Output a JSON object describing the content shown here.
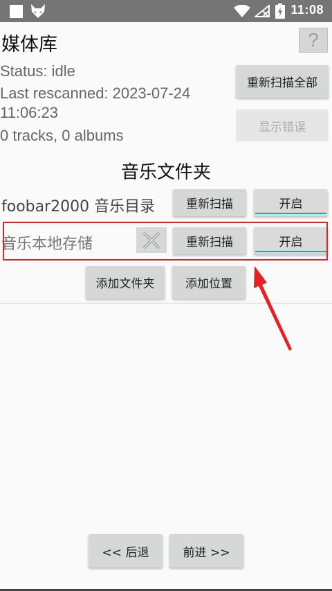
{
  "status_bar": {
    "time": "11:08",
    "icons": [
      "app-square-icon",
      "fox-app-icon",
      "wifi-icon",
      "no-signal-icon",
      "battery-charging-icon"
    ]
  },
  "page": {
    "title": "媒体库",
    "help_label": "?"
  },
  "library": {
    "status": "Status: idle",
    "last_rescanned": "Last rescanned: 2023-07-24",
    "last_rescanned_time": "11:06:23",
    "counts": "0 tracks, 0 albums",
    "rescan_all_label": "重新扫描全部",
    "show_errors_label": "显示错误"
  },
  "folders": {
    "section_title": "音乐文件夹",
    "items": [
      {
        "name": "foobar2000 音乐目录",
        "rescan_label": "重新扫描",
        "toggle_label": "开启",
        "removable": false
      },
      {
        "name": "音乐本地存储",
        "rescan_label": "重新扫描",
        "toggle_label": "开启",
        "removable": true
      }
    ],
    "add_folder_label": "添加文件夹",
    "add_location_label": "添加位置"
  },
  "navigation": {
    "back_label": "<< 后退",
    "next_label": "前进 >>"
  },
  "colors": {
    "status_bar": "#757575",
    "toggle_accent": "#26a69a",
    "highlight": "#e32222"
  }
}
